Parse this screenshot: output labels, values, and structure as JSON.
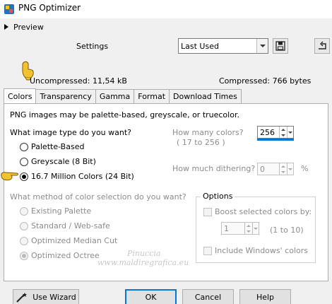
{
  "window": {
    "title": "PNG Optimizer"
  },
  "preview": {
    "label": "Preview"
  },
  "settings": {
    "label": "Settings",
    "selected": "Last Used"
  },
  "sizes": {
    "uncompressed": "Uncompressed: 11,54 kB",
    "compressed": "Compressed: 766 bytes"
  },
  "tabs": [
    {
      "label": "Colors",
      "active": true
    },
    {
      "label": "Transparency",
      "active": false
    },
    {
      "label": "Gamma",
      "active": false
    },
    {
      "label": "Format",
      "active": false
    },
    {
      "label": "Download Times",
      "active": false
    }
  ],
  "colors_tab": {
    "intro": "PNG images may be palette-based, greyscale, or truecolor.",
    "image_type_question": "What image type do you want?",
    "image_types": [
      {
        "label": "Palette-Based",
        "selected": false
      },
      {
        "label": "Greyscale (8 Bit)",
        "selected": false
      },
      {
        "label": "16.7 Million Colors (24 Bit)",
        "selected": true
      }
    ],
    "how_many_colors": {
      "label": "How many colors?",
      "range": "( 17 to 256 )",
      "value": "256"
    },
    "dithering": {
      "label": "How much dithering?",
      "value": "0",
      "unit": "%"
    },
    "method_question": "What method of color selection do you want?",
    "methods": [
      {
        "label": "Existing Palette",
        "selected": false
      },
      {
        "label": "Standard / Web-safe",
        "selected": false
      },
      {
        "label": "Optimized Median Cut",
        "selected": false
      },
      {
        "label": "Optimized Octree",
        "selected": true
      }
    ],
    "options": {
      "title": "Options",
      "boost_label": "Boost selected colors by:",
      "boost_value": "1",
      "boost_range": "(1 to 10)",
      "include_windows_label": "Include Windows' colors"
    }
  },
  "buttons": {
    "wizard": "Use Wizard",
    "ok": "OK",
    "cancel": "Cancel",
    "help": "Help"
  },
  "watermark": {
    "line1": "Pinuccia",
    "line2": "www.maldiregrafica.eu"
  }
}
